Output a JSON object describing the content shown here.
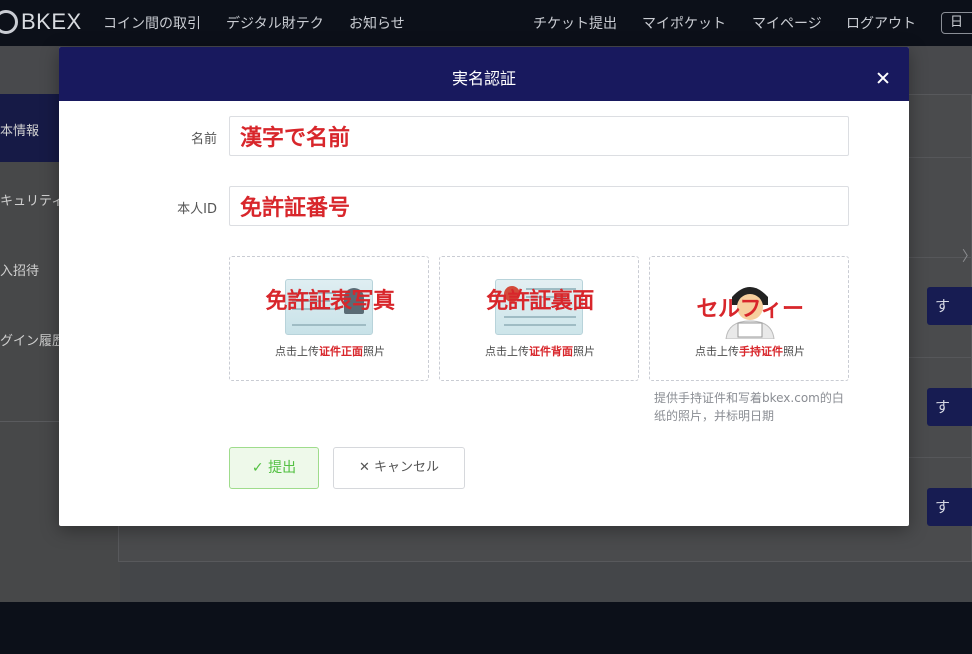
{
  "header": {
    "logo_text": "BKEX",
    "nav_left": [
      "コイン間の取引",
      "デジタル財テク",
      "お知らせ"
    ],
    "nav_right": [
      "チケット提出",
      "マイポケット",
      "マイページ",
      "ログアウト"
    ],
    "lang": "日"
  },
  "sidebar": {
    "items": [
      {
        "label": "本情報"
      },
      {
        "label": "キュリティ"
      },
      {
        "label": "入招待"
      },
      {
        "label": "グイン履歴"
      }
    ]
  },
  "background": {
    "row_button_label": "す",
    "chevron": "〉"
  },
  "modal": {
    "title": "実名認証",
    "name_label": "名前",
    "name_value": "漢字で名前",
    "id_label": "本人ID",
    "id_value": "免許証番号",
    "cards": [
      {
        "overlay": "免許証表写真",
        "caption_pre": "点击上传",
        "caption_em": "证件正面",
        "caption_post": "照片"
      },
      {
        "overlay": "免許証裏面",
        "caption_pre": "点击上传",
        "caption_em": "证件背面",
        "caption_post": "照片"
      },
      {
        "overlay": "セルフィー",
        "caption_pre": "点击上传",
        "caption_em": "手持证件",
        "caption_post": "照片"
      }
    ],
    "hint": "提供手持证件和写着bkex.com的白纸的照片，并标明日期",
    "submit_label": "提出",
    "cancel_label": "キャンセル"
  },
  "colors": {
    "modal_header": "#18195e",
    "accent_red": "#d8262b",
    "submit_green": "#52c041"
  }
}
